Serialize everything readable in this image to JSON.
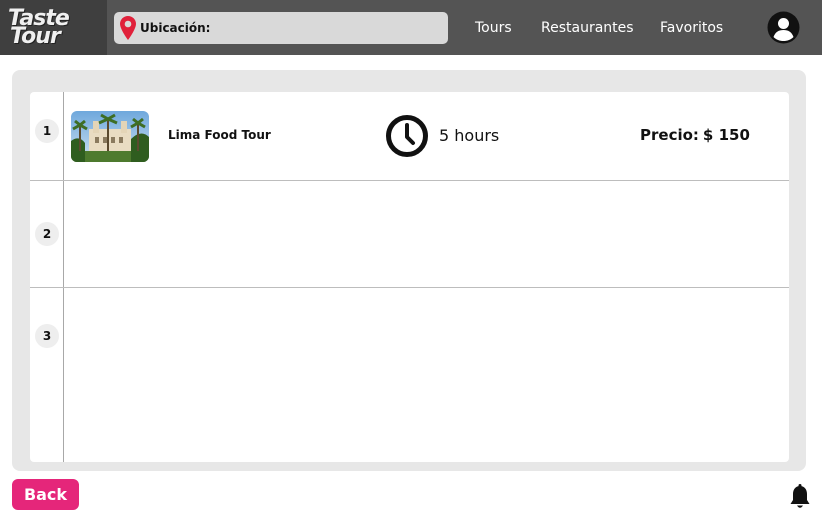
{
  "logo": {
    "line1": "Taste",
    "line2": "Tour"
  },
  "location": {
    "label": "Ubicación:",
    "icon": "map-pin-icon",
    "pin_color": "#e0203a"
  },
  "nav": {
    "tours": "Tours",
    "restaurants": "Restaurantes",
    "favorites": "Favoritos"
  },
  "account": {
    "icon": "user-circle-icon"
  },
  "table": {
    "rows": [
      {
        "num": "1",
        "name": "Lima Food Tour",
        "duration": "5 hours",
        "price_label": "Precio:",
        "price_value": "$ 150",
        "clock_icon": "clock-icon"
      },
      {
        "num": "2"
      },
      {
        "num": "3"
      }
    ]
  },
  "back": {
    "label": "Back",
    "color": "#e5267a"
  },
  "notifications": {
    "icon": "bell-icon"
  }
}
